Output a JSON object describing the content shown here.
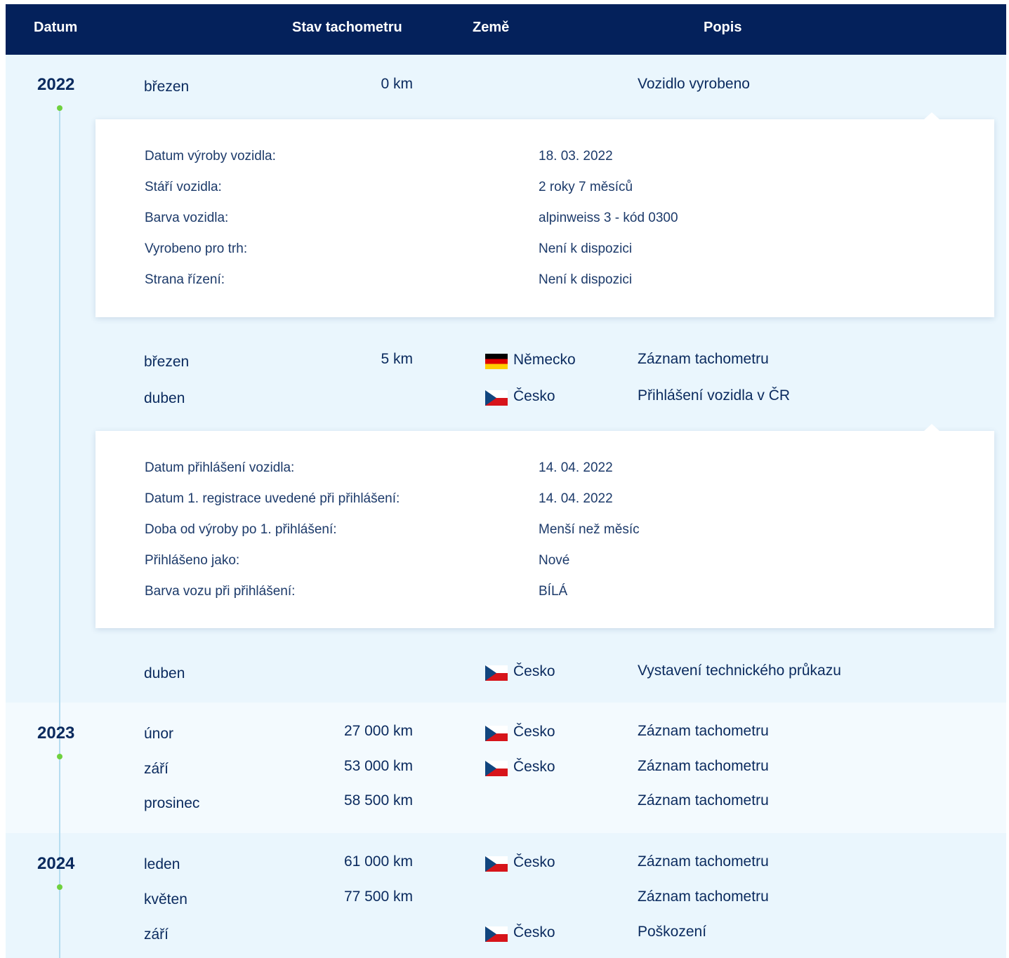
{
  "header": {
    "datum": "Datum",
    "stav": "Stav tachometru",
    "zeme": "Země",
    "popis": "Popis"
  },
  "years": [
    {
      "year": "2022",
      "rows": [
        {
          "month": "březen",
          "km": "0 km",
          "country": "",
          "flag": "",
          "desc": "Vozidlo vyrobeno"
        },
        {
          "month": "březen",
          "km": "5 km",
          "country": "Německo",
          "flag": "flag-de",
          "desc": "Záznam tachometru"
        },
        {
          "month": "duben",
          "km": "",
          "country": "Česko",
          "flag": "flag-cz",
          "desc": "Přihlášení vozidla v ČR"
        },
        {
          "month": "duben",
          "km": "",
          "country": "Česko",
          "flag": "flag-cz",
          "desc": "Vystavení technického průkazu"
        }
      ]
    },
    {
      "year": "2023",
      "rows": [
        {
          "month": "únor",
          "km": "27 000 km",
          "country": "Česko",
          "flag": "flag-cz",
          "desc": "Záznam tachometru"
        },
        {
          "month": "září",
          "km": "53 000 km",
          "country": "Česko",
          "flag": "flag-cz",
          "desc": "Záznam tachometru"
        },
        {
          "month": "prosinec",
          "km": "58 500 km",
          "country": "",
          "flag": "",
          "desc": "Záznam tachometru"
        }
      ]
    },
    {
      "year": "2024",
      "rows": [
        {
          "month": "leden",
          "km": "61 000 km",
          "country": "Česko",
          "flag": "flag-cz",
          "desc": "Záznam tachometru"
        },
        {
          "month": "květen",
          "km": "77 500 km",
          "country": "",
          "flag": "",
          "desc": "Záznam tachometru"
        },
        {
          "month": "září",
          "km": "",
          "country": "Česko",
          "flag": "flag-cz",
          "desc": "Poškození"
        }
      ]
    }
  ],
  "details_production": [
    {
      "key": "Datum výroby vozidla:",
      "value": "18. 03. 2022"
    },
    {
      "key": "Stáří vozidla:",
      "value": "2 roky 7 měsíců"
    },
    {
      "key": "Barva vozidla:",
      "value": "alpinweiss 3 - kód 0300"
    },
    {
      "key": "Vyrobeno pro trh:",
      "value": "Není k dispozici"
    },
    {
      "key": "Strana řízení:",
      "value": "Není k dispozici"
    }
  ],
  "details_registration": [
    {
      "key": "Datum přihlášení vozidla:",
      "value": "14. 04. 2022"
    },
    {
      "key": "Datum 1. registrace uvedené při přihlášení:",
      "value": "14. 04. 2022"
    },
    {
      "key": "Doba od výroby po 1. přihlášení:",
      "value": "Menší než měsíc"
    },
    {
      "key": "Přihlášeno jako:",
      "value": "Nové"
    },
    {
      "key": "Barva vozu při přihlášení:",
      "value": "BÍLÁ"
    }
  ],
  "colors": {
    "header_bg": "#04215b",
    "band_light": "#eaf6fd",
    "band_lighter": "#f3fafe",
    "timeline_dot": "#6fd13e",
    "text": "#0a2a5e"
  }
}
